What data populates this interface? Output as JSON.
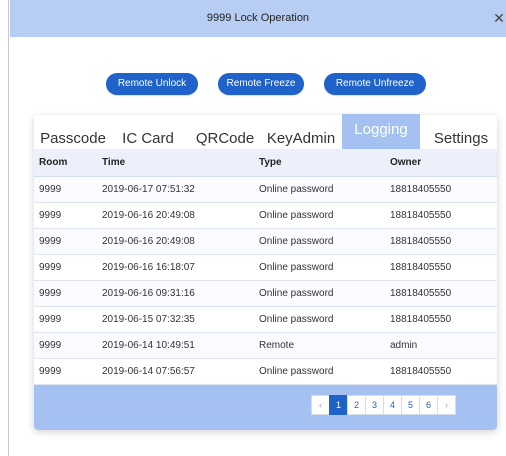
{
  "window": {
    "title": "9999 Lock Operation",
    "close_label": "✕"
  },
  "actions": {
    "remote_unlock": "Remote Unlock",
    "remote_freeze": "Remote Freeze",
    "remote_unfreeze": "Remote Unfreeze"
  },
  "tabs": [
    "Passcode",
    "IC Card",
    "QRCode",
    "KeyAdmin",
    "Logging",
    "Settings"
  ],
  "active_tab": "Logging",
  "table": {
    "headers": [
      "Room",
      "Time",
      "Type",
      "Owner"
    ],
    "rows": [
      [
        "9999",
        "2019-06-17 07:51:32",
        "Online password",
        "18818405550"
      ],
      [
        "9999",
        "2019-06-16 20:49:08",
        "Online password",
        "18818405550"
      ],
      [
        "9999",
        "2019-06-16 20:49:08",
        "Online password",
        "18818405550"
      ],
      [
        "9999",
        "2019-06-16 16:18:07",
        "Online password",
        "18818405550"
      ],
      [
        "9999",
        "2019-06-16 09:31:16",
        "Online password",
        "18818405550"
      ],
      [
        "9999",
        "2019-06-15 07:32:35",
        "Online password",
        "18818405550"
      ],
      [
        "9999",
        "2019-06-14 10:49:51",
        "Remote",
        "admin"
      ],
      [
        "9999",
        "2019-06-14 07:56:57",
        "Online password",
        "18818405550"
      ]
    ]
  },
  "pagination": {
    "prev": "‹",
    "next": "›",
    "pages": [
      "1",
      "2",
      "3",
      "4",
      "5",
      "6"
    ],
    "current": "1"
  },
  "colors": {
    "titlebar": "#b8cdf3",
    "button": "#1f62c9",
    "active_tab": "#a5c1f2"
  }
}
